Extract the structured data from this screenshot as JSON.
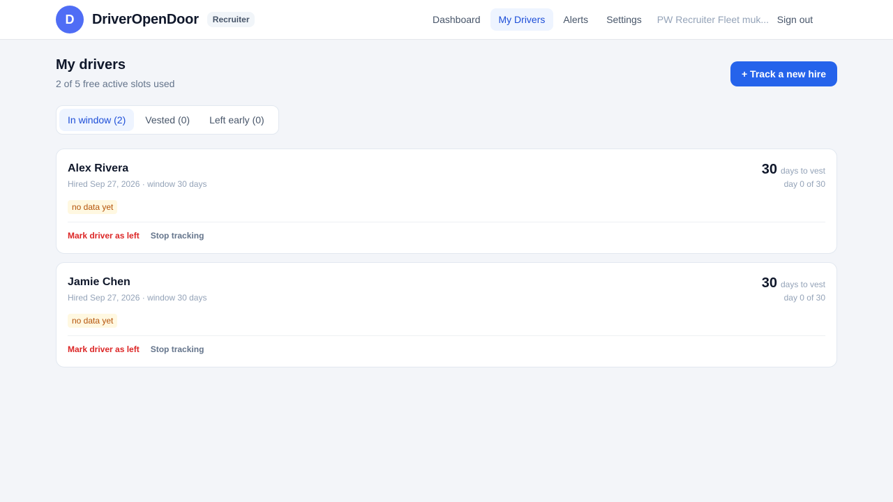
{
  "app": {
    "logo_letter": "D",
    "name": "DriverOpenDoor",
    "role_badge": "Recruiter"
  },
  "nav": {
    "items": [
      {
        "label": "Dashboard",
        "active": false
      },
      {
        "label": "My Drivers",
        "active": true
      },
      {
        "label": "Alerts",
        "active": false
      },
      {
        "label": "Settings",
        "active": false
      }
    ],
    "account": "PW Recruiter Fleet muk...",
    "sign_out": "Sign out"
  },
  "page": {
    "title": "My drivers",
    "subtitle": "2 of 5 free active slots used",
    "track_button": "+ Track a new hire"
  },
  "tabs": [
    {
      "label": "In window (2)",
      "active": true
    },
    {
      "label": "Vested (0)",
      "active": false
    },
    {
      "label": "Left early (0)",
      "active": false
    }
  ],
  "drivers": [
    {
      "name": "Alex Rivera",
      "meta": "Hired Sep 27, 2026 · window 30 days",
      "badge": "no data yet",
      "days": "30",
      "days_label": "days to vest",
      "progress": "day 0 of 30",
      "action_left": "Mark driver as left",
      "action_stop": "Stop tracking"
    },
    {
      "name": "Jamie Chen",
      "meta": "Hired Sep 27, 2026 · window 30 days",
      "badge": "no data yet",
      "days": "30",
      "days_label": "days to vest",
      "progress": "day 0 of 30",
      "action_left": "Mark driver as left",
      "action_stop": "Stop tracking"
    }
  ],
  "colors": {
    "accent": "#2563eb",
    "danger": "#dc2626",
    "warning_badge_bg": "#fff8e1"
  }
}
